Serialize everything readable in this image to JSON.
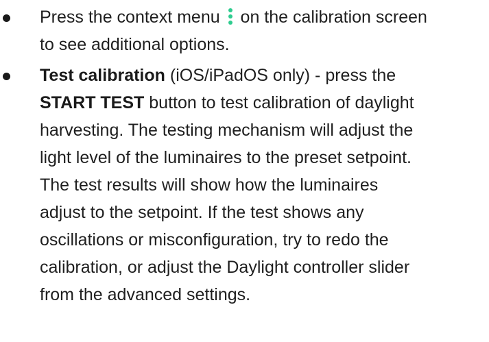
{
  "colors": {
    "text": "#1f1f1f",
    "accent_icon": "#2ecc8f"
  },
  "icons": {
    "context_menu": "vertical-ellipsis-icon"
  },
  "bullets": [
    {
      "line1_before_icon": "Press the context menu",
      "line1_after_icon": "on the calibration screen",
      "line2": "to see additional options."
    },
    {
      "bold_title": "Test calibration",
      "line1_rest": " (iOS/iPadOS only) - press the",
      "line2_bold": "START TEST",
      "line2_rest": " button to test calibration of daylight",
      "lines": [
        "harvesting. The testing mechanism will adjust the",
        "light level of the luminaires to the preset setpoint.",
        "The test results will show how the luminaires",
        "adjust to the setpoint. If the test shows any",
        "oscillations or misconfiguration, try to redo the",
        "calibration, or adjust the Daylight controller slider",
        "from the advanced settings."
      ]
    }
  ]
}
